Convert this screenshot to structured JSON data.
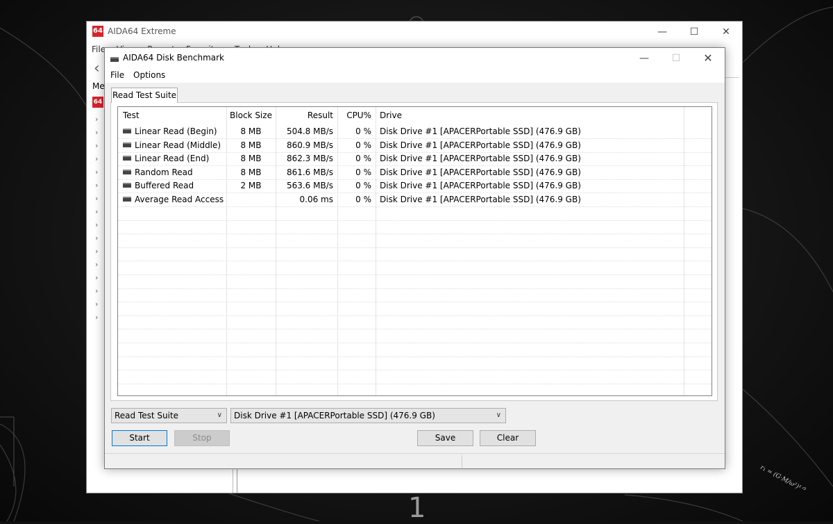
{
  "desktop": {
    "number": "1",
    "formula": "r₁ = (G·M/ω²)¹ᐟ³"
  },
  "main_window": {
    "title": "AIDA64 Extreme",
    "logo_text": "64",
    "menu": [
      "File",
      "View",
      "Report",
      "Favorites",
      "Tools",
      "Help"
    ],
    "sidebar_tab": "Me",
    "controls": {
      "minimize": "—",
      "maximize": "☐",
      "close": "✕"
    }
  },
  "bench": {
    "title": "AIDA64 Disk Benchmark",
    "menu": [
      "File",
      "Options"
    ],
    "controls": {
      "minimize": "—",
      "maximize": "☐",
      "close": "✕"
    },
    "tab_label": "Read Test Suite",
    "columns": [
      "Test",
      "Block Size",
      "Result",
      "CPU%",
      "Drive"
    ],
    "rows": [
      {
        "test": "Linear Read (Begin)",
        "block": "8 MB",
        "result": "504.8 MB/s",
        "cpu": "0 %",
        "drive": "Disk Drive #1  [APACERPortable SSD]  (476.9 GB)"
      },
      {
        "test": "Linear Read (Middle)",
        "block": "8 MB",
        "result": "860.9 MB/s",
        "cpu": "0 %",
        "drive": "Disk Drive #1  [APACERPortable SSD]  (476.9 GB)"
      },
      {
        "test": "Linear Read (End)",
        "block": "8 MB",
        "result": "862.3 MB/s",
        "cpu": "0 %",
        "drive": "Disk Drive #1  [APACERPortable SSD]  (476.9 GB)"
      },
      {
        "test": "Random Read",
        "block": "8 MB",
        "result": "861.6 MB/s",
        "cpu": "0 %",
        "drive": "Disk Drive #1  [APACERPortable SSD]  (476.9 GB)"
      },
      {
        "test": "Buffered Read",
        "block": "2 MB",
        "result": "563.6 MB/s",
        "cpu": "0 %",
        "drive": "Disk Drive #1  [APACERPortable SSD]  (476.9 GB)"
      },
      {
        "test": "Average Read Access",
        "block": "",
        "result": "0.06 ms",
        "cpu": "0 %",
        "drive": "Disk Drive #1  [APACERPortable SSD]  (476.9 GB)"
      }
    ],
    "suite_select": "Read Test Suite",
    "drive_select": "Disk Drive #1  [APACERPortable SSD]  (476.9 GB)",
    "buttons": {
      "start": "Start",
      "stop": "Stop",
      "save": "Save",
      "clear": "Clear"
    }
  },
  "colors": {
    "logo_red": "#d8232a",
    "focus_blue": "#0078d7"
  }
}
